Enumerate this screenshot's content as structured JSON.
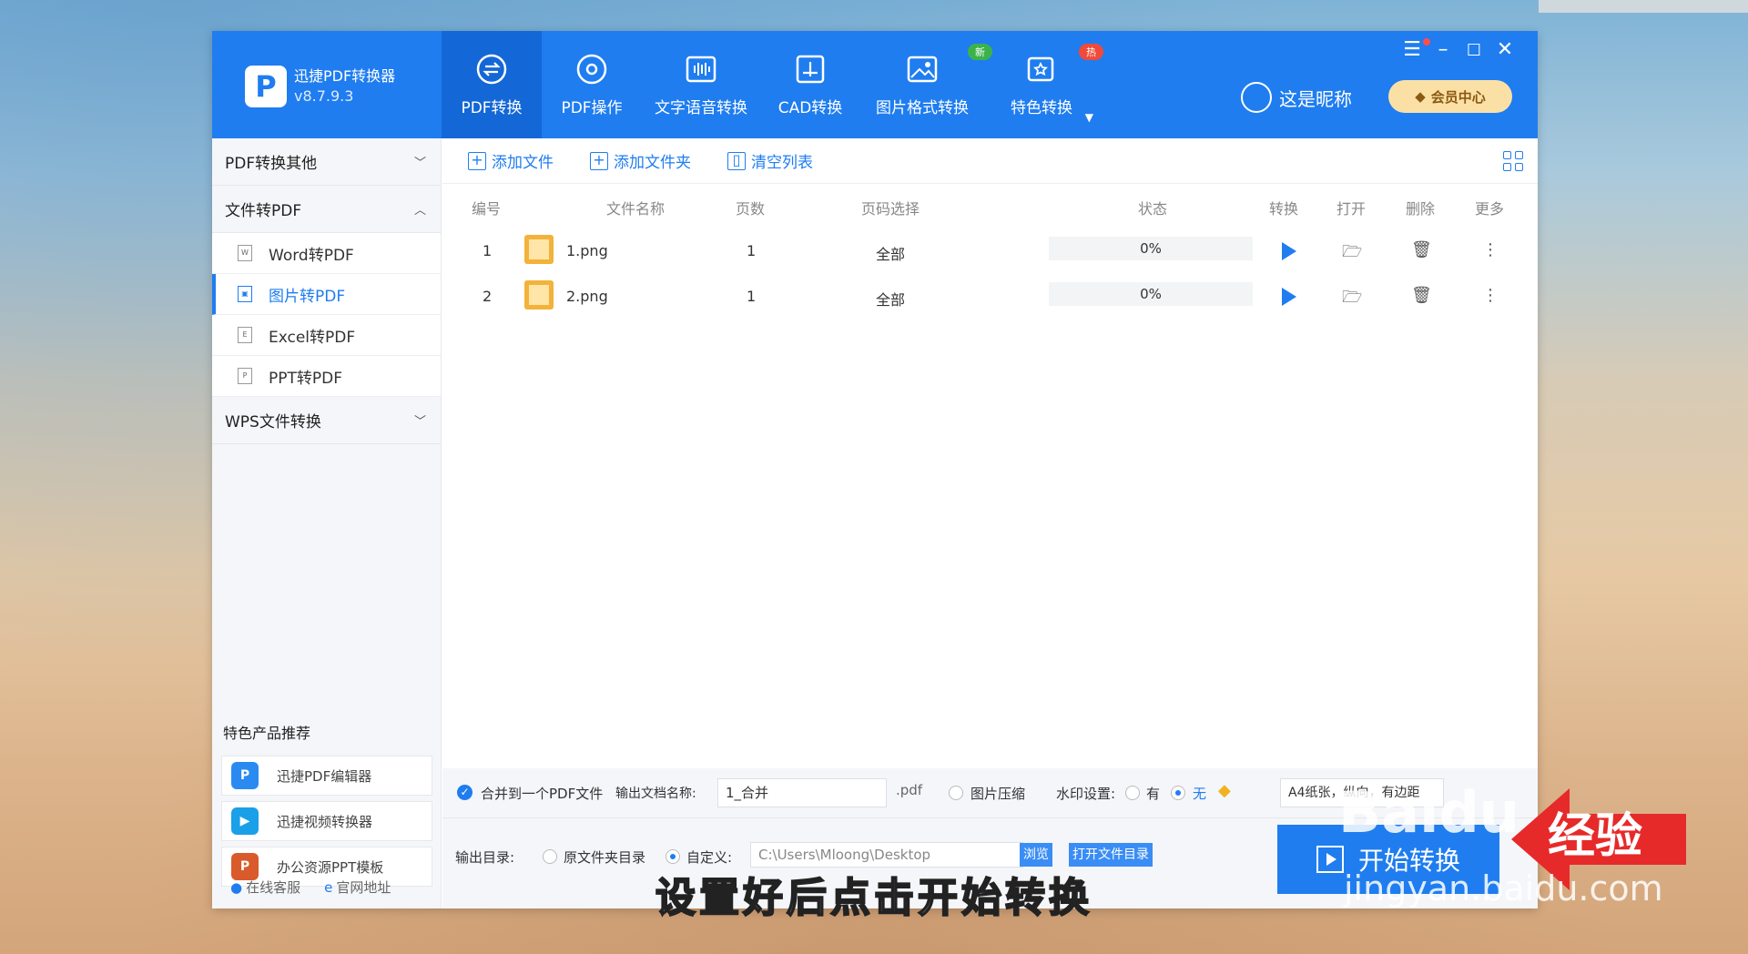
{
  "app": {
    "name": "迅捷PDF转换器",
    "version": "v8.7.9.3"
  },
  "nav": [
    {
      "label": "PDF转换",
      "icon": "pdf-convert-icon"
    },
    {
      "label": "PDF操作",
      "icon": "pdf-ops-icon"
    },
    {
      "label": "文字语音转换",
      "icon": "voice-icon"
    },
    {
      "label": "CAD转换",
      "icon": "cad-icon"
    },
    {
      "label": "图片格式转换",
      "icon": "image-icon",
      "badge": "新"
    },
    {
      "label": "特色转换",
      "icon": "special-icon",
      "badge": "热"
    }
  ],
  "user": {
    "name": "这是昵称",
    "vip": "会员中心"
  },
  "colors": {
    "accent": "#1f7df0",
    "badge_new": "#3cb34a",
    "badge_hot": "#f04a3a"
  },
  "sidebar": {
    "groups": [
      "PDF转换其他",
      "文件转PDF",
      "WPS文件转换"
    ],
    "items": [
      {
        "label": "Word转PDF",
        "icon": "W"
      },
      {
        "label": "图片转PDF",
        "icon": "▣"
      },
      {
        "label": "Excel转PDF",
        "icon": "E"
      },
      {
        "label": "PPT转PDF",
        "icon": "P"
      }
    ],
    "promo_title": "特色产品推荐",
    "promos": [
      "迅捷PDF编辑器",
      "迅捷视频转换器",
      "办公资源PPT模板"
    ],
    "footer": [
      "在线客服",
      "官网地址"
    ]
  },
  "toolbar": {
    "add_file": "添加文件",
    "add_folder": "添加文件夹",
    "clear": "清空列表"
  },
  "table": {
    "headers": [
      "编号",
      "文件名称",
      "页数",
      "页码选择",
      "状态",
      "转换",
      "打开",
      "删除",
      "更多"
    ],
    "rows": [
      {
        "no": "1",
        "name": "1.png",
        "pages": "1",
        "range": "全部",
        "status": "0%"
      },
      {
        "no": "2",
        "name": "2.png",
        "pages": "1",
        "range": "全部",
        "status": "0%"
      }
    ]
  },
  "options": {
    "merge": "合并到一个PDF文件",
    "out_name_label": "输出文档名称:",
    "out_name": "1_合并",
    "ext": ".pdf",
    "compress": "图片压缩",
    "watermark_label": "水印设置:",
    "wm_yes": "有",
    "wm_no": "无",
    "paper": "A4纸张，纵向，有边距"
  },
  "output": {
    "label": "输出目录:",
    "orig": "原文件夹目录",
    "custom": "自定义:",
    "path": "C:\\Users\\Mloong\\Desktop",
    "browse": "浏览",
    "open_dir": "打开文件目录",
    "start": "开始转换"
  },
  "caption": "设置好后点击开始转换",
  "watermark": {
    "brand": "Baidu",
    "cn": "经验",
    "url": "jingyan.baidu.com"
  }
}
